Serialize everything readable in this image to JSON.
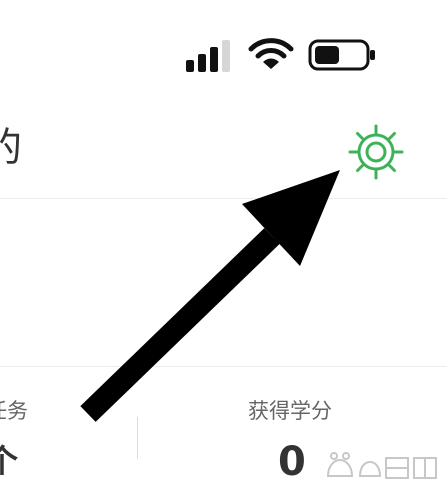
{
  "header": {
    "title": "的"
  },
  "stats": {
    "left": {
      "label": "任务",
      "value": "个"
    },
    "right": {
      "label": "获得学分",
      "value": "0"
    }
  },
  "icons": {
    "signal": "cellular-signal-icon",
    "wifi": "wifi-icon",
    "battery": "battery-icon",
    "settings": "gear-icon",
    "arrow": "arrow-annotation"
  },
  "colors": {
    "settings_accent": "#3cb35a",
    "text_primary": "#333333",
    "text_secondary": "#666666",
    "divider": "#ececec",
    "arrow": "#000000"
  }
}
